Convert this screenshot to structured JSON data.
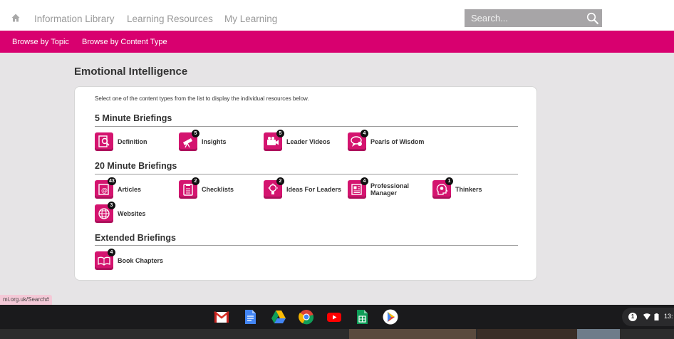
{
  "topnav": {
    "home_icon": "home-icon",
    "links": [
      "Information Library",
      "Learning Resources",
      "My Learning"
    ],
    "search_placeholder": "Search...",
    "search_icon": "search-icon"
  },
  "subnav": {
    "links": [
      "Browse by Topic",
      "Browse by Content Type"
    ]
  },
  "page": {
    "title": "Emotional Intelligence",
    "intro": "Select one of the content types from the list to display the individual resources below."
  },
  "sections": [
    {
      "title": "5 Minute Briefings",
      "items": [
        {
          "label": "Definition",
          "count": "",
          "icon": "definition-icon"
        },
        {
          "label": "Insights",
          "count": "5",
          "icon": "telescope-icon"
        },
        {
          "label": "Leader Videos",
          "count": "5",
          "icon": "video-camera-icon"
        },
        {
          "label": "Pearls of Wisdom",
          "count": "4",
          "icon": "speech-bubbles-icon"
        }
      ]
    },
    {
      "title": "20 Minute Briefings",
      "items": [
        {
          "label": "Articles",
          "count": "43",
          "icon": "article-icon"
        },
        {
          "label": "Checklists",
          "count": "2",
          "icon": "checklist-icon"
        },
        {
          "label": "Ideas For Leaders",
          "count": "2",
          "icon": "lightbulb-icon"
        },
        {
          "label": "Professional Manager",
          "count": "4",
          "icon": "magazine-icon"
        },
        {
          "label": "Thinkers",
          "count": "1",
          "icon": "head-gear-icon"
        },
        {
          "label": "Websites",
          "count": "3",
          "icon": "globe-icon"
        }
      ]
    },
    {
      "title": "Extended Briefings",
      "items": [
        {
          "label": "Book Chapters",
          "count": "4",
          "icon": "open-book-icon"
        }
      ]
    }
  ],
  "status_url": "mi.org.uk/Search#",
  "shelf": {
    "apps": [
      "gmail-icon",
      "docs-icon",
      "drive-icon",
      "chrome-icon",
      "youtube-icon",
      "sheets-icon",
      "play-store-icon"
    ],
    "notification_count": "1",
    "time": "13:"
  },
  "colors": {
    "accent": "#d8006f",
    "icon_bg": "#d4146f"
  }
}
